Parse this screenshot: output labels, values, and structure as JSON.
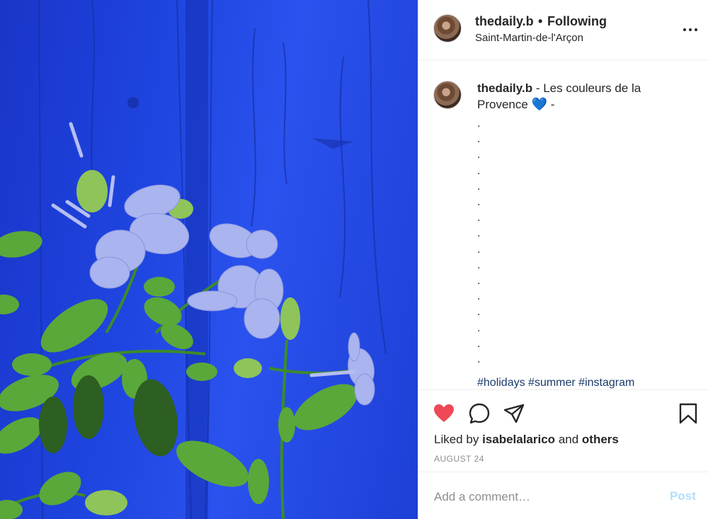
{
  "header": {
    "username": "thedaily.b",
    "separator": "•",
    "follow_status": "Following",
    "location": "Saint-Martin-de-l'Arçon"
  },
  "caption": {
    "username": "thedaily.b",
    "text": "- Les couleurs de la Provence",
    "emoji": "💙",
    "trailing": "-",
    "dot_lines": [
      ".",
      ".",
      ".",
      ".",
      ".",
      ".",
      ".",
      ".",
      ".",
      ".",
      ".",
      ".",
      ".",
      ".",
      ".",
      "."
    ],
    "hashtags": "#holidays #summer #instagram"
  },
  "actions": {
    "liked_prefix": "Liked by",
    "liked_user": "isabelalarico",
    "liked_and": "and",
    "liked_others": "others",
    "date": "AUGUST 24"
  },
  "comment": {
    "placeholder": "Add a comment…",
    "post_label": "Post"
  },
  "colors": {
    "heart": "#ed4956",
    "photo_blue": "#1f45e0",
    "post_disabled": "#b2dffc"
  },
  "icons": {
    "like": "heart-icon",
    "comment": "comment-bubble-icon",
    "share": "paper-plane-icon",
    "save": "bookmark-icon",
    "more": "more-options-icon"
  }
}
